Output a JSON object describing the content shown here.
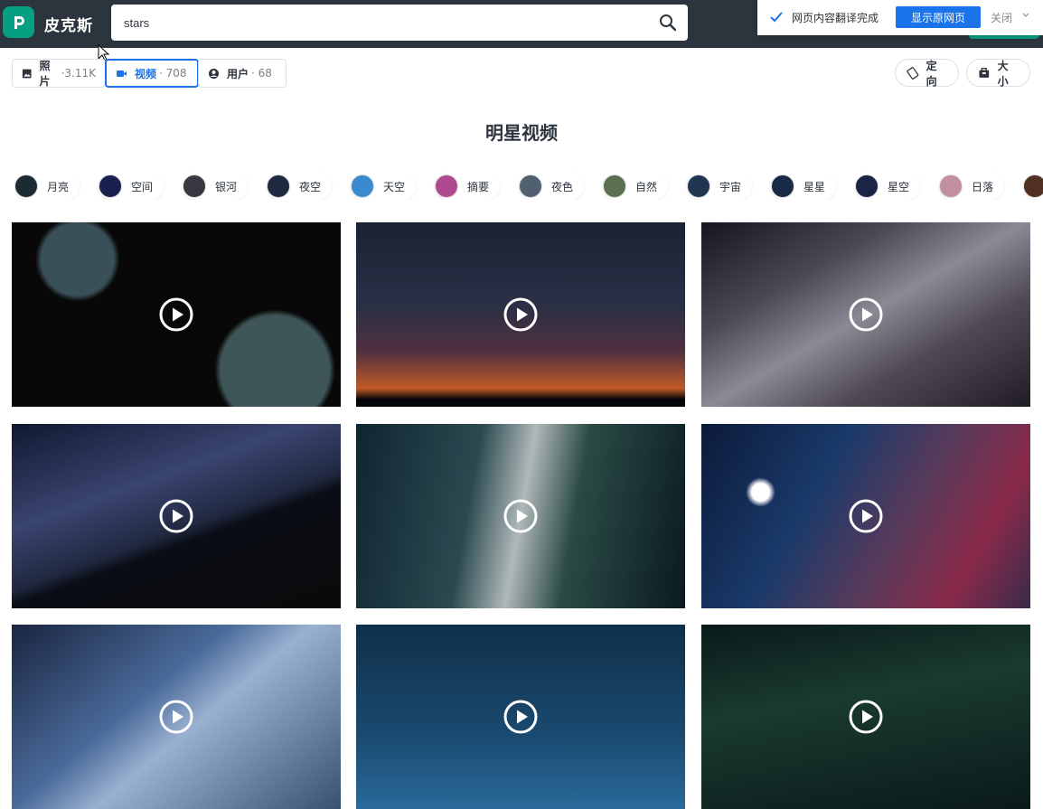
{
  "header": {
    "brand": "皮克斯",
    "search_value": "stars"
  },
  "translate_bar": {
    "message": "网页内容翻译完成",
    "show_original": "显示原网页",
    "close": "关闭"
  },
  "tabs": [
    {
      "label": "照片",
      "count": "·3.11K",
      "icon": "image-icon"
    },
    {
      "label": "视频",
      "count": "· 708",
      "icon": "video-camera-icon"
    },
    {
      "label": "用户",
      "count": "· 68",
      "icon": "user-icon"
    }
  ],
  "filters": {
    "orientation": "定向",
    "size": "大小"
  },
  "page_title": "明星视频",
  "chips": [
    {
      "label": "月亮",
      "color": "#1c2a34"
    },
    {
      "label": "空间",
      "color": "#1a2050"
    },
    {
      "label": "银河",
      "color": "#3a3640"
    },
    {
      "label": "夜空",
      "color": "#1f2a40"
    },
    {
      "label": "天空",
      "color": "#3a8ad0"
    },
    {
      "label": "摘要",
      "color": "#b04a90"
    },
    {
      "label": "夜色",
      "color": "#506070"
    },
    {
      "label": "自然",
      "color": "#5a7050"
    },
    {
      "label": "宇宙",
      "color": "#203550"
    },
    {
      "label": "星星",
      "color": "#182a45"
    },
    {
      "label": "星空",
      "color": "#1a2545"
    },
    {
      "label": "日落",
      "color": "#c090a0"
    },
    {
      "label": "",
      "color": "#503020"
    }
  ],
  "videos": [
    {
      "bg": "radial-gradient(circle at 20% 20%, #3a5058 0 12%, transparent 14%), radial-gradient(circle at 80% 80%, #3e5658 0 18%, transparent 20%), #080808"
    },
    {
      "bg": "linear-gradient(180deg, #1a2235 0%, #2a3045 45%, #503040 70%, #c05a28 90%, #04050a 96%)"
    },
    {
      "bg": "linear-gradient(150deg, #151520 0%, #4a4a55 30%, #8a8a95 50%, #504a55 70%, #201c25 100%)"
    },
    {
      "bg": "linear-gradient(160deg, #101830 0%, #3a4570 35%, #202840 55%, #0a0d15 60%, #0a0a0a 100%)"
    },
    {
      "bg": "linear-gradient(100deg, #102530 0%, #2a4a50 35%, #b0b8b8 50%, #2a4a45 65%, #0a1a20 100%)"
    },
    {
      "bg": "radial-gradient(circle at 18% 37%, #ffffff 0 3%, transparent 5%), linear-gradient(120deg, #0c1a3a 0%, #1a3a6a 35%, #5a3a5a 60%, #8a2a4a 80%, #3a2a4a 100%)"
    },
    {
      "bg": "linear-gradient(140deg, #1a2540 0%, #4a6a9a 40%, #9ab0d0 55%, #3a5070 100%)"
    },
    {
      "bg": "linear-gradient(180deg, #10304a 0%, #1a4a70 60%, #2a6a9a 100%)"
    },
    {
      "bg": "linear-gradient(170deg, #0a1a1a 0%, #1a3a30 40%, #0a1a1a 100%)"
    }
  ]
}
